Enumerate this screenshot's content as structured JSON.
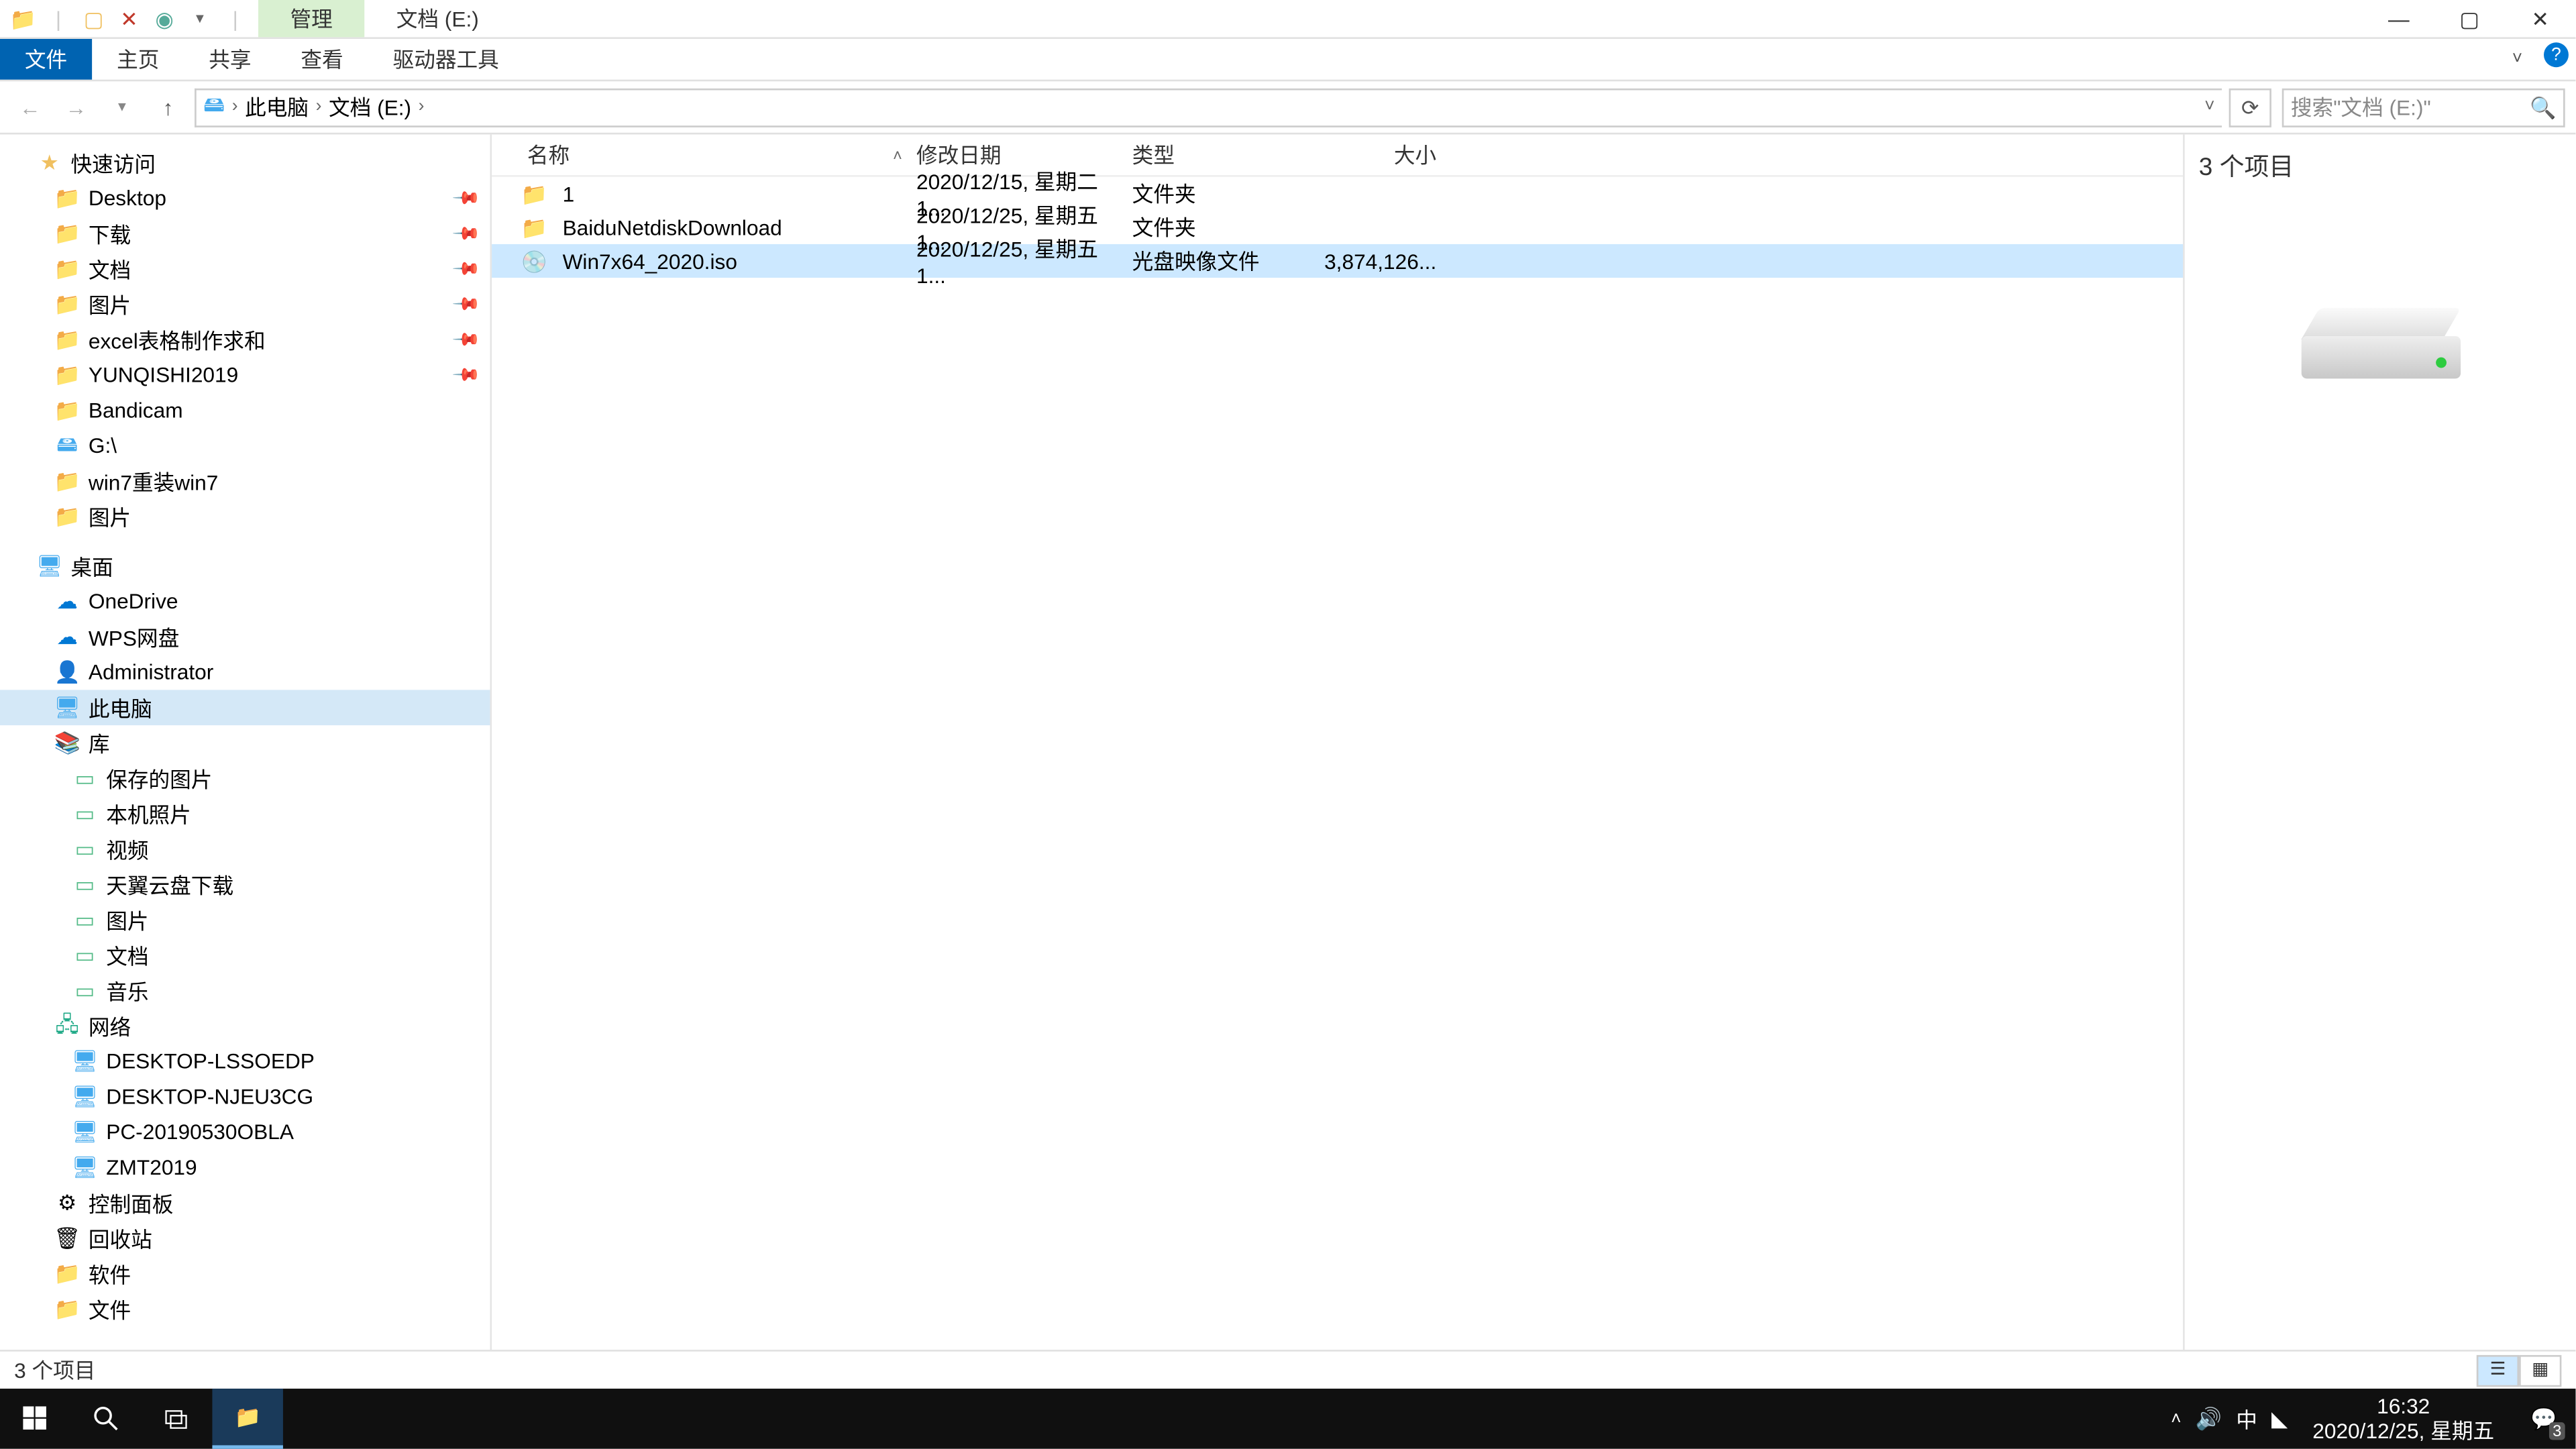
{
  "titlebar": {
    "context_tab": "管理",
    "title": "文档 (E:)"
  },
  "ribbon": {
    "file": "文件",
    "tabs": [
      "主页",
      "共享",
      "查看",
      "驱动器工具"
    ]
  },
  "nav": {
    "breadcrumb": [
      "此电脑",
      "文档 (E:)"
    ],
    "search_placeholder": "搜索\"文档 (E:)\""
  },
  "navpane": {
    "quick_access": "快速访问",
    "qa_items": [
      {
        "label": "Desktop",
        "icon": "desktop"
      },
      {
        "label": "下载",
        "icon": "folder"
      },
      {
        "label": "文档",
        "icon": "folder"
      },
      {
        "label": "图片",
        "icon": "folder"
      },
      {
        "label": "excel表格制作求和",
        "icon": "folder"
      },
      {
        "label": "YUNQISHI2019",
        "icon": "folder"
      },
      {
        "label": "Bandicam",
        "icon": "folder"
      },
      {
        "label": "G:\\",
        "icon": "drive"
      },
      {
        "label": "win7重装win7",
        "icon": "folder"
      },
      {
        "label": "图片",
        "icon": "folder"
      }
    ],
    "desktop": "桌面",
    "desktop_items": [
      {
        "label": "OneDrive",
        "icon": "onedrive"
      },
      {
        "label": "WPS网盘",
        "icon": "onedrive"
      },
      {
        "label": "Administrator",
        "icon": "user"
      },
      {
        "label": "此电脑",
        "icon": "pc",
        "selected": true
      },
      {
        "label": "库",
        "icon": "lib"
      }
    ],
    "lib_items": [
      {
        "label": "保存的图片"
      },
      {
        "label": "本机照片"
      },
      {
        "label": "视频"
      },
      {
        "label": "天翼云盘下载"
      },
      {
        "label": "图片"
      },
      {
        "label": "文档"
      },
      {
        "label": "音乐"
      }
    ],
    "network": "网络",
    "network_items": [
      {
        "label": "DESKTOP-LSSOEDP"
      },
      {
        "label": "DESKTOP-NJEU3CG"
      },
      {
        "label": "PC-20190530OBLA"
      },
      {
        "label": "ZMT2019"
      }
    ],
    "extra": [
      {
        "label": "控制面板",
        "icon": "control"
      },
      {
        "label": "回收站",
        "icon": "recycle"
      },
      {
        "label": "软件",
        "icon": "folder"
      },
      {
        "label": "文件",
        "icon": "folder"
      }
    ]
  },
  "columns": {
    "name": "名称",
    "date": "修改日期",
    "type": "类型",
    "size": "大小"
  },
  "files": [
    {
      "name": "1",
      "date": "2020/12/15, 星期二 1...",
      "type": "文件夹",
      "size": "",
      "icon": "folder"
    },
    {
      "name": "BaiduNetdiskDownload",
      "date": "2020/12/25, 星期五 1...",
      "type": "文件夹",
      "size": "",
      "icon": "folder"
    },
    {
      "name": "Win7x64_2020.iso",
      "date": "2020/12/25, 星期五 1...",
      "type": "光盘映像文件",
      "size": "3,874,126...",
      "icon": "disc",
      "selected": true
    }
  ],
  "preview": {
    "count": "3 个项目"
  },
  "statusbar": {
    "text": "3 个项目"
  },
  "taskbar": {
    "time": "16:32",
    "date": "2020/12/25, 星期五",
    "ime": "中",
    "notif_count": "3"
  }
}
